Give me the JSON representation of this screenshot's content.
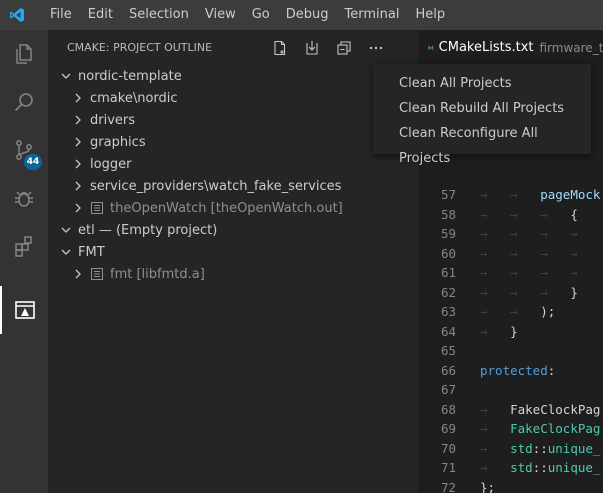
{
  "menubar": {
    "items": [
      "File",
      "Edit",
      "Selection",
      "View",
      "Go",
      "Debug",
      "Terminal",
      "Help"
    ]
  },
  "activity": {
    "source_control_badge": "44"
  },
  "sidebar": {
    "title": "CMAKE: PROJECT OUTLINE",
    "tree": [
      {
        "label": "nordic-template",
        "depth": 0,
        "expanded": true,
        "muted": false,
        "icon": ""
      },
      {
        "label": "cmake\\nordic",
        "depth": 1,
        "expanded": false,
        "muted": false,
        "icon": ""
      },
      {
        "label": "drivers",
        "depth": 1,
        "expanded": false,
        "muted": false,
        "icon": ""
      },
      {
        "label": "graphics",
        "depth": 1,
        "expanded": false,
        "muted": false,
        "icon": ""
      },
      {
        "label": "logger",
        "depth": 1,
        "expanded": false,
        "muted": false,
        "icon": ""
      },
      {
        "label": "service_providers\\watch_fake_services",
        "depth": 1,
        "expanded": false,
        "muted": false,
        "icon": ""
      },
      {
        "label": "theOpenWatch [theOpenWatch.out]",
        "depth": 1,
        "expanded": false,
        "muted": true,
        "icon": "exe-target-icon"
      },
      {
        "label": "etl — (Empty project)",
        "depth": 0,
        "expanded": true,
        "muted": false,
        "icon": ""
      },
      {
        "label": "FMT",
        "depth": 0,
        "expanded": true,
        "muted": false,
        "icon": ""
      },
      {
        "label": "fmt [libfmtd.a]",
        "depth": 1,
        "expanded": false,
        "muted": true,
        "icon": "library-target-icon"
      }
    ]
  },
  "editor": {
    "tab": {
      "filename": "CMakeLists.txt",
      "subtitle": "firmware_tests"
    },
    "lines": [
      {
        "n": "57",
        "tokens": [
          {
            "t": "→   →   ",
            "c": "ws"
          },
          {
            "t": "pageMock",
            "c": "#9cdcfe"
          }
        ]
      },
      {
        "n": "58",
        "tokens": [
          {
            "t": "→   →   →   ",
            "c": "ws"
          },
          {
            "t": "{",
            "c": "#d4d4d4"
          }
        ]
      },
      {
        "n": "59",
        "tokens": [
          {
            "t": "→   →   →   →   ",
            "c": "ws"
          }
        ]
      },
      {
        "n": "60",
        "tokens": [
          {
            "t": "→   →   →   →   ",
            "c": "ws"
          }
        ]
      },
      {
        "n": "61",
        "tokens": [
          {
            "t": "→   →   →   →   ",
            "c": "ws"
          }
        ]
      },
      {
        "n": "62",
        "tokens": [
          {
            "t": "→   →   →   ",
            "c": "ws"
          },
          {
            "t": "}",
            "c": "#d4d4d4"
          }
        ]
      },
      {
        "n": "63",
        "tokens": [
          {
            "t": "→   →   ",
            "c": "ws"
          },
          {
            "t": ");",
            "c": "#d4d4d4"
          }
        ]
      },
      {
        "n": "64",
        "tokens": [
          {
            "t": "→   ",
            "c": "ws"
          },
          {
            "t": "}",
            "c": "#d4d4d4"
          }
        ]
      },
      {
        "n": "65",
        "tokens": []
      },
      {
        "n": "66",
        "tokens": [
          {
            "t": "protected",
            "c": "#569cd6"
          },
          {
            "t": ":",
            "c": "#d4d4d4"
          }
        ]
      },
      {
        "n": "67",
        "tokens": []
      },
      {
        "n": "68",
        "tokens": [
          {
            "t": "→   ",
            "c": "ws"
          },
          {
            "t": "FakeClockPag",
            "c": "#d4d4d4"
          }
        ]
      },
      {
        "n": "69",
        "tokens": [
          {
            "t": "→   ",
            "c": "ws"
          },
          {
            "t": "FakeClockPag",
            "c": "#4ec9b0"
          }
        ]
      },
      {
        "n": "70",
        "tokens": [
          {
            "t": "→   ",
            "c": "ws"
          },
          {
            "t": "std",
            "c": "#4ec9b0"
          },
          {
            "t": "::",
            "c": "#d4d4d4"
          },
          {
            "t": "unique_",
            "c": "#4ec9b0"
          }
        ]
      },
      {
        "n": "71",
        "tokens": [
          {
            "t": "→   ",
            "c": "ws"
          },
          {
            "t": "std",
            "c": "#4ec9b0"
          },
          {
            "t": "::",
            "c": "#d4d4d4"
          },
          {
            "t": "unique_",
            "c": "#4ec9b0"
          }
        ]
      },
      {
        "n": "72",
        "tokens": [
          {
            "t": "};",
            "c": "#d4d4d4"
          }
        ]
      }
    ]
  },
  "context_menu": {
    "items": [
      "Clean All Projects",
      "Clean Rebuild All Projects",
      "Clean Reconfigure All Projects"
    ]
  },
  "colors": {
    "titlebar": "#3c3c3c",
    "activitybar": "#333333",
    "sidebar": "#252526",
    "editor": "#1e1e1e",
    "accent": "#007acc",
    "badge": "#0e639c"
  }
}
